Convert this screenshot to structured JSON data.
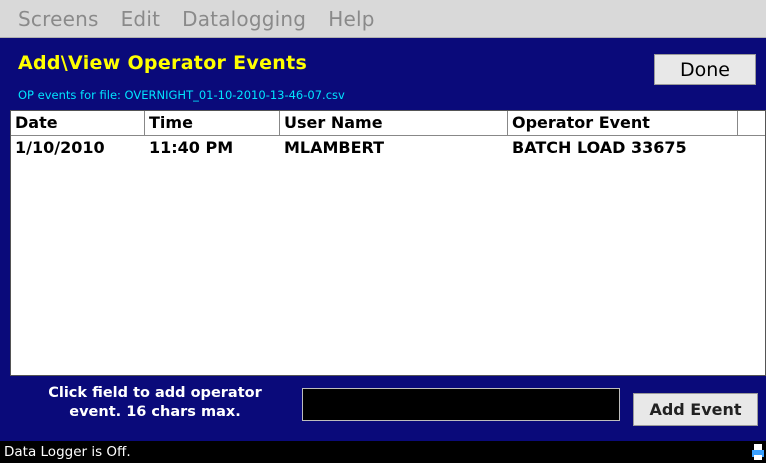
{
  "menu": {
    "items": [
      {
        "label": "Screens"
      },
      {
        "label": "Edit"
      },
      {
        "label": "Datalogging"
      },
      {
        "label": "Help"
      }
    ]
  },
  "panel": {
    "title": "Add\\View Operator Events",
    "subtitle": "OP events for file: OVERNIGHT_01-10-2010-13-46-07.csv",
    "done_label": "Done"
  },
  "table": {
    "columns": [
      "Date",
      "Time",
      "User Name",
      "Operator Event",
      ""
    ],
    "rows": [
      [
        "1/10/2010",
        "11:40 PM",
        "MLAMBERT",
        "BATCH LOAD 33675"
      ]
    ]
  },
  "entry": {
    "hint_line1": "Click field to add operator",
    "hint_line2": "event. 16 chars max.",
    "input_value": "",
    "add_label": "Add Event"
  },
  "status": {
    "text": "Data Logger is Off.",
    "icon": "printer-icon"
  },
  "colors": {
    "panel_bg": "#0a0a7a",
    "title": "#ffff00",
    "subtitle": "#00e5ff"
  }
}
